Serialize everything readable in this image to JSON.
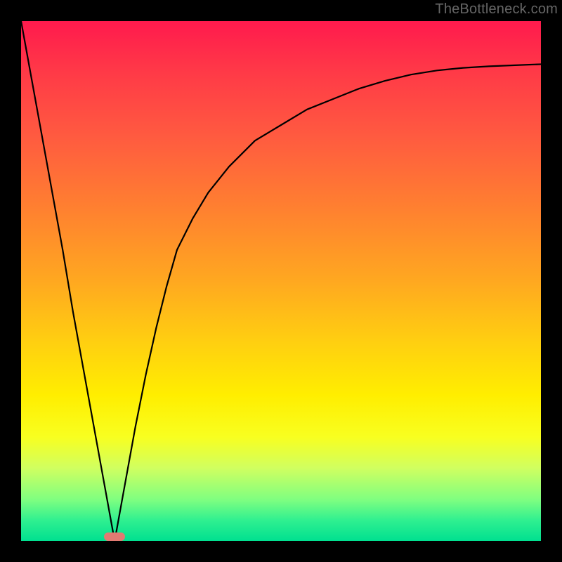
{
  "watermark": "TheBottleneck.com",
  "chart_data": {
    "type": "line",
    "title": "",
    "xlabel": "",
    "ylabel": "",
    "xlim": [
      0,
      100
    ],
    "ylim": [
      0,
      100
    ],
    "series": [
      {
        "name": "curve",
        "x": [
          0,
          2,
          4,
          6,
          8,
          10,
          12,
          14,
          16,
          18,
          20,
          22,
          24,
          26,
          28,
          30,
          33,
          36,
          40,
          45,
          50,
          55,
          60,
          65,
          70,
          75,
          80,
          85,
          90,
          95,
          100
        ],
        "y": [
          100,
          89,
          78,
          67,
          56,
          44,
          33,
          22,
          11,
          0,
          11,
          22,
          32,
          41,
          49,
          56,
          62,
          67,
          72,
          77,
          80,
          83,
          85,
          87,
          88.5,
          89.7,
          90.5,
          91,
          91.3,
          91.5,
          91.7
        ]
      }
    ],
    "marker": {
      "x_center": 18,
      "y_center": 0.8,
      "color": "#e27a72"
    }
  }
}
